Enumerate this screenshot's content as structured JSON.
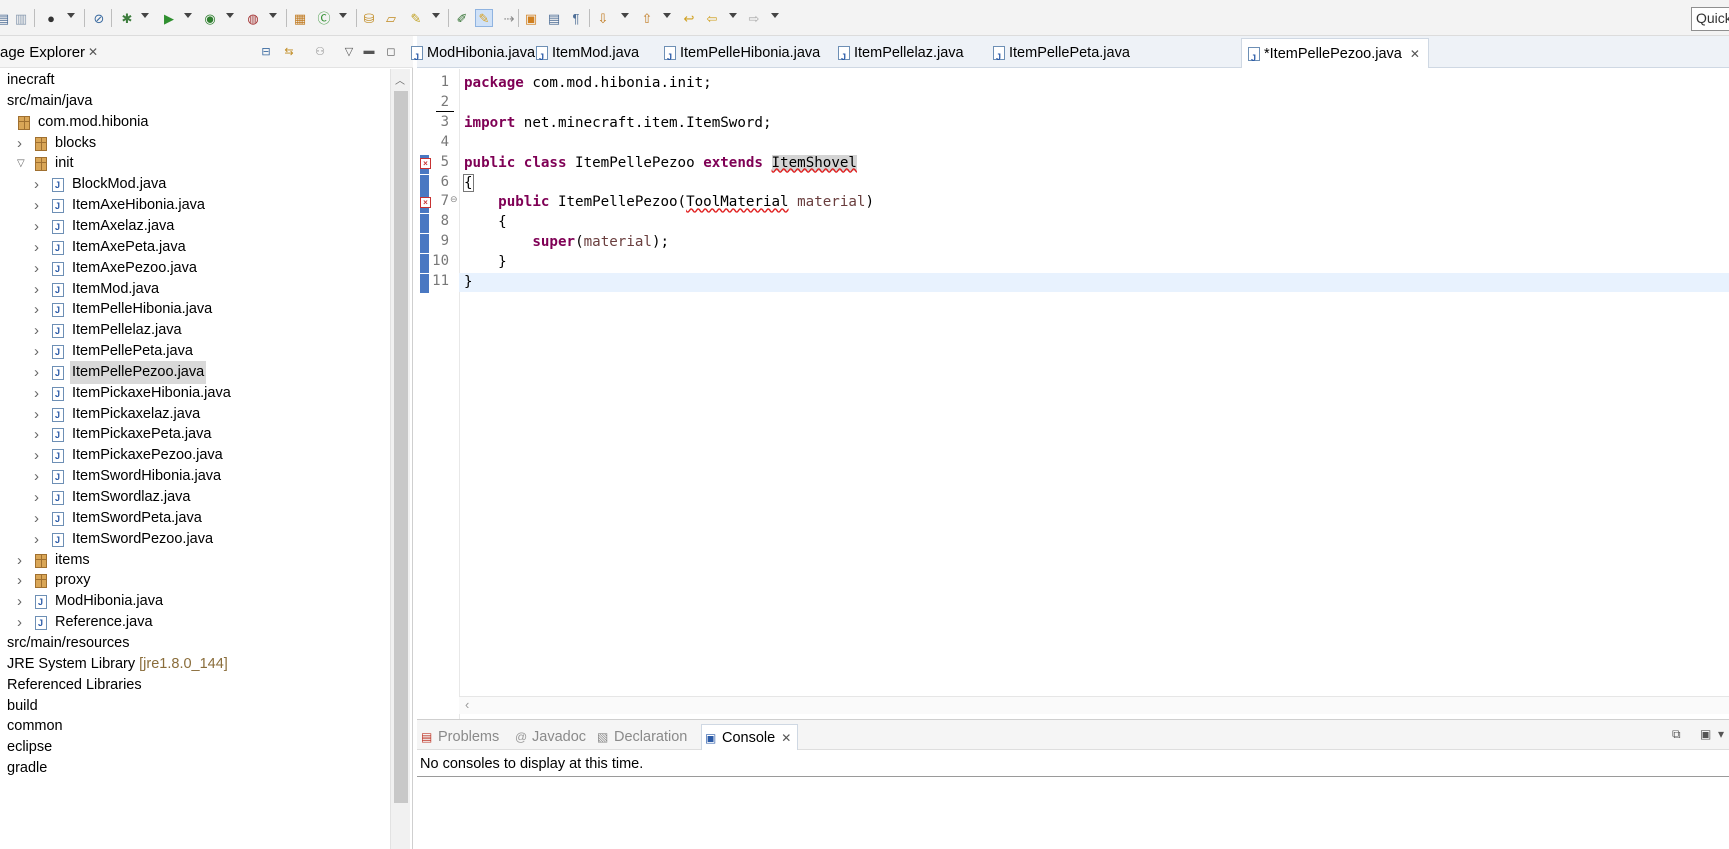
{
  "toolbar": {
    "quick_access": "Quick"
  },
  "explorer": {
    "title": "age Explorer",
    "tree": [
      {
        "label": "inecraft",
        "kind": "project",
        "depth": 0
      },
      {
        "label": "src/main/java",
        "kind": "srcfolder",
        "depth": 0
      },
      {
        "label": "com.mod.hibonia",
        "kind": "pkg",
        "depth": 1
      },
      {
        "label": "blocks",
        "kind": "pkg",
        "depth": 2,
        "twisty": "closed"
      },
      {
        "label": "init",
        "kind": "pkg",
        "depth": 2,
        "twisty": "open"
      },
      {
        "label": "BlockMod.java",
        "kind": "java",
        "depth": 3,
        "twisty": "closed"
      },
      {
        "label": "ItemAxeHibonia.java",
        "kind": "java",
        "depth": 3,
        "twisty": "closed"
      },
      {
        "label": "ItemAxelaz.java",
        "kind": "java",
        "depth": 3,
        "twisty": "closed"
      },
      {
        "label": "ItemAxePeta.java",
        "kind": "java",
        "depth": 3,
        "twisty": "closed"
      },
      {
        "label": "ItemAxePezoo.java",
        "kind": "java",
        "depth": 3,
        "twisty": "closed"
      },
      {
        "label": "ItemMod.java",
        "kind": "java",
        "depth": 3,
        "twisty": "closed"
      },
      {
        "label": "ItemPelleHibonia.java",
        "kind": "java",
        "depth": 3,
        "twisty": "closed"
      },
      {
        "label": "ItemPellelaz.java",
        "kind": "java",
        "depth": 3,
        "twisty": "closed"
      },
      {
        "label": "ItemPellePeta.java",
        "kind": "java",
        "depth": 3,
        "twisty": "closed"
      },
      {
        "label": "ItemPellePezoo.java",
        "kind": "java",
        "depth": 3,
        "twisty": "closed",
        "selected": true
      },
      {
        "label": "ItemPickaxeHibonia.java",
        "kind": "java",
        "depth": 3,
        "twisty": "closed"
      },
      {
        "label": "ItemPickaxelaz.java",
        "kind": "java",
        "depth": 3,
        "twisty": "closed"
      },
      {
        "label": "ItemPickaxePeta.java",
        "kind": "java",
        "depth": 3,
        "twisty": "closed"
      },
      {
        "label": "ItemPickaxePezoo.java",
        "kind": "java",
        "depth": 3,
        "twisty": "closed"
      },
      {
        "label": "ItemSwordHibonia.java",
        "kind": "java",
        "depth": 3,
        "twisty": "closed"
      },
      {
        "label": "ItemSwordlaz.java",
        "kind": "java",
        "depth": 3,
        "twisty": "closed"
      },
      {
        "label": "ItemSwordPeta.java",
        "kind": "java",
        "depth": 3,
        "twisty": "closed"
      },
      {
        "label": "ItemSwordPezoo.java",
        "kind": "java",
        "depth": 3,
        "twisty": "closed"
      },
      {
        "label": "items",
        "kind": "pkg",
        "depth": 2,
        "twisty": "closed"
      },
      {
        "label": "proxy",
        "kind": "pkg",
        "depth": 2,
        "twisty": "closed"
      },
      {
        "label": "ModHibonia.java",
        "kind": "java",
        "depth": 2,
        "twisty": "closed"
      },
      {
        "label": "Reference.java",
        "kind": "java",
        "depth": 2,
        "twisty": "closed"
      },
      {
        "label": "src/main/resources",
        "kind": "srcfolder",
        "depth": 0
      },
      {
        "label": "JRE System Library",
        "deco": "[jre1.8.0_144]",
        "kind": "lib",
        "depth": 0
      },
      {
        "label": "Referenced Libraries",
        "kind": "lib",
        "depth": 0
      },
      {
        "label": "build",
        "kind": "folder",
        "depth": 0
      },
      {
        "label": "common",
        "kind": "folder",
        "depth": 0
      },
      {
        "label": "eclipse",
        "kind": "folder",
        "depth": 0
      },
      {
        "label": "gradle",
        "kind": "folder",
        "depth": 0
      }
    ]
  },
  "editor": {
    "tabs": [
      {
        "label": "ModHibonia.java",
        "active": false
      },
      {
        "label": "ItemMod.java",
        "active": false
      },
      {
        "label": "ItemPelleHibonia.java",
        "active": false
      },
      {
        "label": "ItemPellelaz.java",
        "active": false
      },
      {
        "label": "ItemPellePeta.java",
        "active": false
      },
      {
        "label": "*ItemPellePezoo.java",
        "active": true
      }
    ],
    "lines": [
      {
        "n": "1",
        "tokens": [
          {
            "t": "package",
            "c": "kw"
          },
          {
            "t": " com.mod.hibonia.init;"
          }
        ]
      },
      {
        "n": "2",
        "tokens": []
      },
      {
        "n": "3",
        "tokens": [
          {
            "t": "import",
            "c": "kw"
          },
          {
            "t": " net.minecraft.item.ItemSword;"
          }
        ]
      },
      {
        "n": "4",
        "tokens": []
      },
      {
        "n": "5",
        "error": true,
        "tokens": [
          {
            "t": "public",
            "c": "kw"
          },
          {
            "t": " "
          },
          {
            "t": "class",
            "c": "kw"
          },
          {
            "t": " ItemPellePezoo "
          },
          {
            "t": "extends",
            "c": "kw"
          },
          {
            "t": " "
          },
          {
            "t": "ItemShovel",
            "c": "errword hl"
          }
        ]
      },
      {
        "n": "6",
        "tokens": [
          {
            "t": "{",
            "c": "caret-brace"
          }
        ]
      },
      {
        "n": "7",
        "error": true,
        "fold": true,
        "tokens": [
          {
            "t": "    "
          },
          {
            "t": "public",
            "c": "kw"
          },
          {
            "t": " ItemPellePezoo("
          },
          {
            "t": "ToolMaterial",
            "c": "errword"
          },
          {
            "t": " "
          },
          {
            "t": "material",
            "c": "param"
          },
          {
            "t": ")"
          }
        ]
      },
      {
        "n": "8",
        "tokens": [
          {
            "t": "    {"
          }
        ]
      },
      {
        "n": "9",
        "tokens": [
          {
            "t": "        "
          },
          {
            "t": "super",
            "c": "kw"
          },
          {
            "t": "("
          },
          {
            "t": "material",
            "c": "param"
          },
          {
            "t": ");"
          }
        ]
      },
      {
        "n": "10",
        "tokens": [
          {
            "t": "    }"
          }
        ]
      },
      {
        "n": "11",
        "current": true,
        "tokens": [
          {
            "t": "}"
          }
        ]
      }
    ]
  },
  "console": {
    "tabs": [
      {
        "label": "Problems",
        "icon": "problems-icon",
        "active": false
      },
      {
        "label": "Javadoc",
        "icon": "javadoc-icon",
        "active": false
      },
      {
        "label": "Declaration",
        "icon": "declaration-icon",
        "active": false
      },
      {
        "label": "Console",
        "icon": "console-icon",
        "active": true
      }
    ],
    "message": "No consoles to display at this time."
  },
  "colors": {
    "keyword": "#7f0055",
    "parameter": "#6a3e3e",
    "error_underline": "#e02020",
    "current_line": "#e8f2fe",
    "line_marker": "#4a78c2"
  }
}
